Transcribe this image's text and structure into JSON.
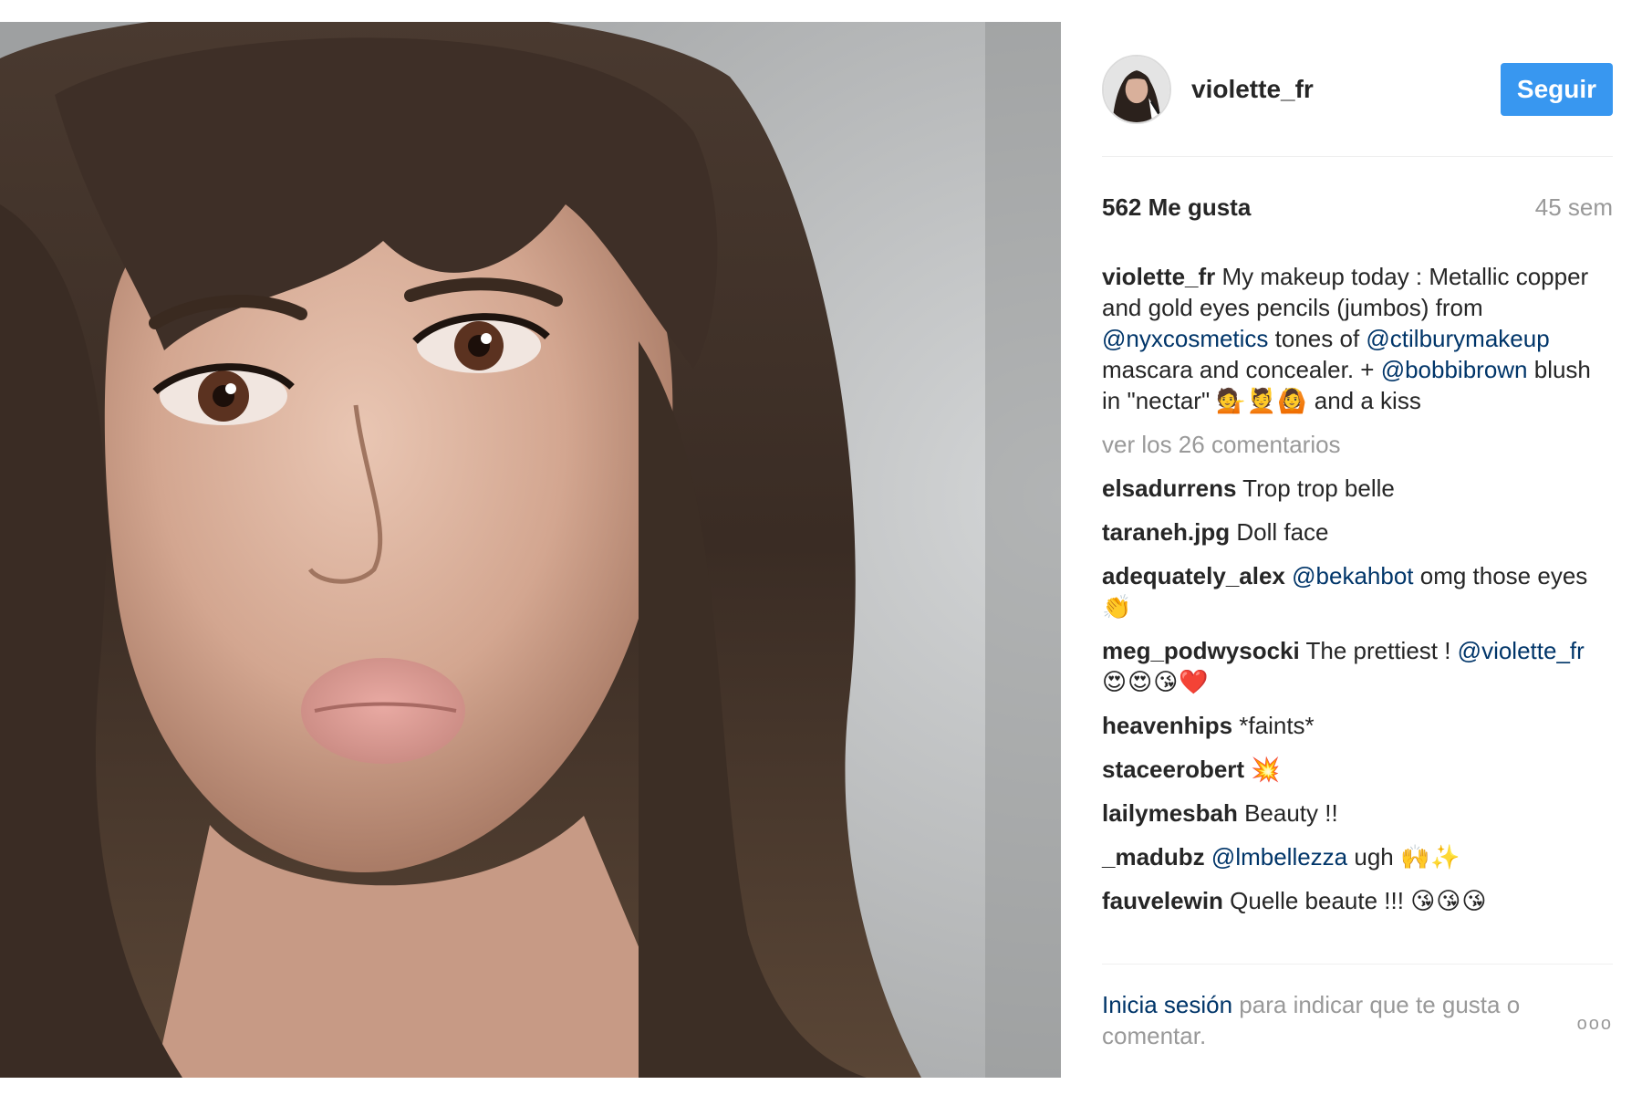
{
  "post": {
    "image_alt": "selfie"
  },
  "header": {
    "username": "violette_fr",
    "follow_label": "Seguir"
  },
  "meta": {
    "likes": "562 Me gusta",
    "time": "45 sem"
  },
  "caption": {
    "user": "violette_fr",
    "text_1": " My makeup today : Metallic copper and gold eyes pencils (jumbos) from ",
    "mention_1": "@nyxcosmetics",
    "text_2": " tones of ",
    "mention_2": "@ctilburymakeup",
    "text_3": " mascara and concealer. + ",
    "mention_3": "@bobbibrown",
    "text_4": " blush in \"nectar\" ",
    "emoji": "💁💆🙆",
    "text_5": " and a kiss"
  },
  "more_comments": "ver los 26 comentarios",
  "comments": [
    {
      "user": "elsadurrens",
      "text": " Trop trop belle"
    },
    {
      "user": "taraneh.jpg",
      "text": " Doll face"
    },
    {
      "user": "adequately_alex",
      "mention": "@bekahbot",
      "text": " omg those eyes ",
      "emoji": "👏"
    },
    {
      "user": "meg_podwysocki",
      "text": " The prettiest ! ",
      "mention": "@violette_fr",
      "emoji": "😍😍😘❤️"
    },
    {
      "user": "heavenhips",
      "text": " *faints*"
    },
    {
      "user": "staceerobert",
      "text": " ",
      "emoji": "💥"
    },
    {
      "user": "lailymesbah",
      "text": " Beauty !!"
    },
    {
      "user": "_madubz",
      "mention": "@lmbellezza",
      "text": " ugh ",
      "emoji": "🙌✨"
    },
    {
      "user": "fauvelewin",
      "text": " Quelle beaute !!! ",
      "emoji": "😘😘😘"
    }
  ],
  "footer": {
    "login_link": "Inicia sesión",
    "login_text": " para indicar que te gusta o comentar.",
    "more_options": "ooo"
  },
  "colors": {
    "follow_button": "#3897f0",
    "mention": "#003569",
    "muted": "#999999",
    "text": "#262626"
  },
  "icons": {
    "more_options": "ellipsis-icon"
  }
}
